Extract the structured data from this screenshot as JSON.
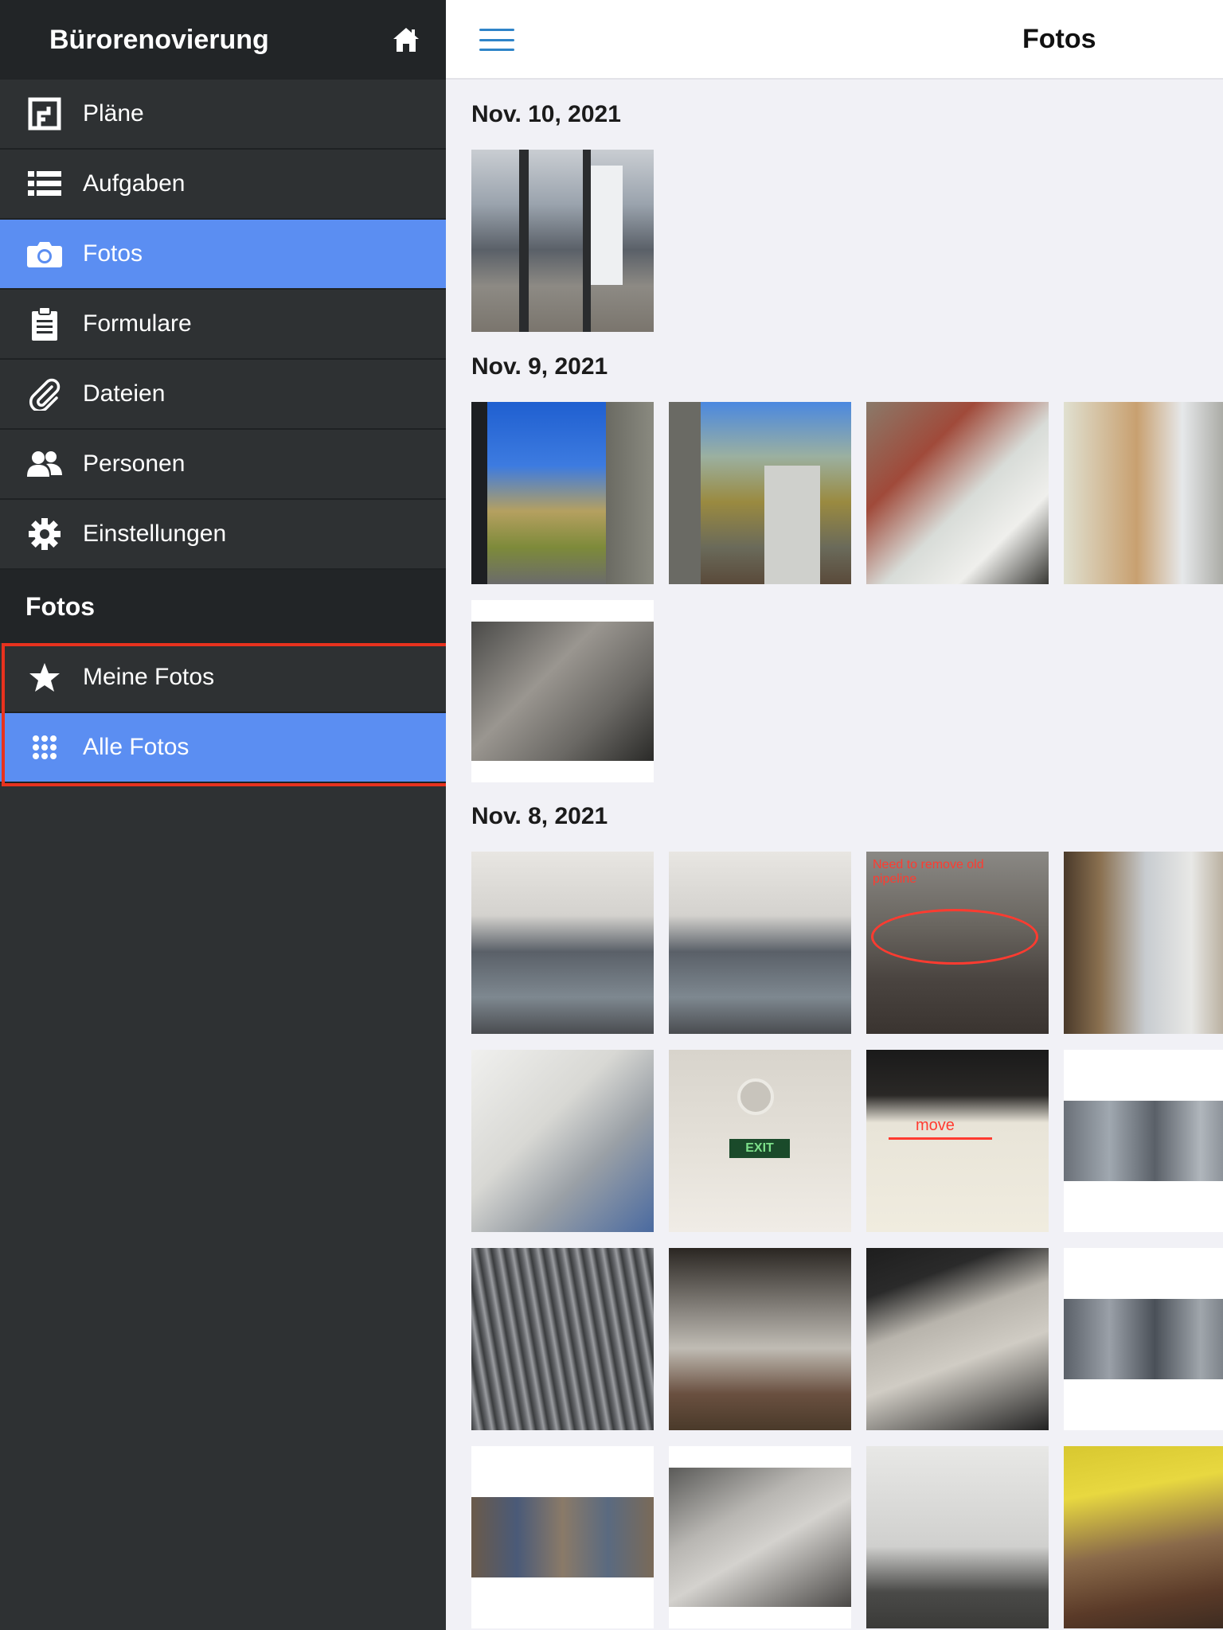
{
  "sidebar": {
    "project_title": "Bürorenovierung",
    "nav": [
      {
        "label": "Pläne",
        "icon": "floorplan-icon"
      },
      {
        "label": "Aufgaben",
        "icon": "list-icon"
      },
      {
        "label": "Fotos",
        "icon": "camera-icon",
        "active": true
      },
      {
        "label": "Formulare",
        "icon": "clipboard-icon"
      },
      {
        "label": "Dateien",
        "icon": "paperclip-icon"
      },
      {
        "label": "Personen",
        "icon": "people-icon"
      },
      {
        "label": "Einstellungen",
        "icon": "gear-icon"
      }
    ],
    "section_title": "Fotos",
    "sub_nav": [
      {
        "label": "Meine Fotos",
        "icon": "star-icon"
      },
      {
        "label": "Alle Fotos",
        "icon": "grid-dots-icon",
        "active": true
      }
    ]
  },
  "header": {
    "title": "Fotos"
  },
  "photo_groups": [
    {
      "date": "Nov. 10, 2021",
      "count": 1
    },
    {
      "date": "Nov. 9, 2021",
      "count": 5
    },
    {
      "date": "Nov. 8, 2021",
      "count": 16
    }
  ],
  "annotations": {
    "pipeline_note": "Need to remove old pipeline",
    "move_note": "move",
    "exit_sign": "EXIT"
  },
  "colors": {
    "sidebar_bg": "#2e3133",
    "sidebar_header_bg": "#222527",
    "active_bg": "#5b8ef2",
    "highlight_border": "#e8321e",
    "menu_icon": "#2f84c8"
  }
}
